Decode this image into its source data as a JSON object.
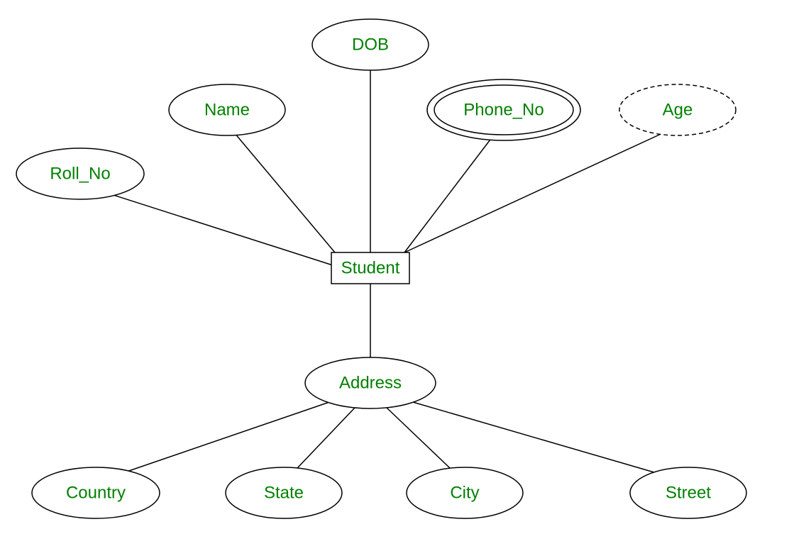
{
  "diagram": {
    "entity": "Student",
    "attributes": {
      "dob": "DOB",
      "name": "Name",
      "phone_no": "Phone_No",
      "age": "Age",
      "roll_no": "Roll_No",
      "address": "Address"
    },
    "address_sub": {
      "country": "Country",
      "state": "State",
      "city": "City",
      "street": "Street"
    }
  }
}
